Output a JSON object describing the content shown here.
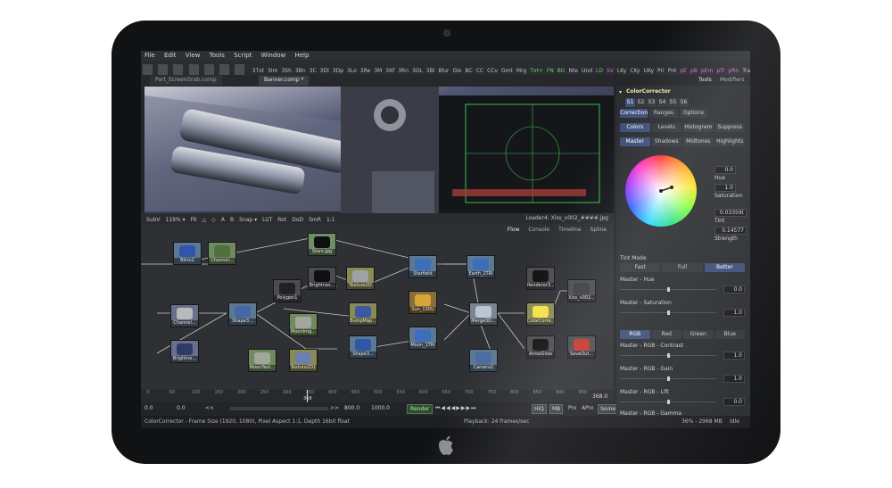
{
  "menu": [
    "File",
    "Edit",
    "View",
    "Tools",
    "Script",
    "Window",
    "Help"
  ],
  "toolbar": [
    {
      "label": "3Txt",
      "c": ""
    },
    {
      "label": "3Im",
      "c": ""
    },
    {
      "label": "3Sh",
      "c": ""
    },
    {
      "label": "3Bn",
      "c": ""
    },
    {
      "label": "3C",
      "c": ""
    },
    {
      "label": "3Dl",
      "c": ""
    },
    {
      "label": "3Dp",
      "c": ""
    },
    {
      "label": "3Lo",
      "c": ""
    },
    {
      "label": "3Re",
      "c": ""
    },
    {
      "label": "3M",
      "c": ""
    },
    {
      "label": "3Xf",
      "c": ""
    },
    {
      "label": "3Rn",
      "c": ""
    },
    {
      "label": "3DL",
      "c": ""
    },
    {
      "label": "3Bl",
      "c": ""
    },
    {
      "label": "Blur",
      "c": ""
    },
    {
      "label": "Glo",
      "c": ""
    },
    {
      "label": "BC",
      "c": ""
    },
    {
      "label": "CC",
      "c": ""
    },
    {
      "label": "CCv",
      "c": ""
    },
    {
      "label": "Gmt",
      "c": ""
    },
    {
      "label": "Mrg",
      "c": ""
    },
    {
      "label": "Txt+",
      "c": "g"
    },
    {
      "label": "FN",
      "c": "g"
    },
    {
      "label": "BG",
      "c": "g"
    },
    {
      "label": "Nte",
      "c": ""
    },
    {
      "label": "Und",
      "c": ""
    },
    {
      "label": "LD",
      "c": "g"
    },
    {
      "label": "SV",
      "c": "p"
    },
    {
      "label": "LKy",
      "c": ""
    },
    {
      "label": "CKy",
      "c": ""
    },
    {
      "label": "UKy",
      "c": ""
    },
    {
      "label": "Pri",
      "c": ""
    },
    {
      "label": "Pnt",
      "c": ""
    },
    {
      "label": "pE",
      "c": "p"
    },
    {
      "label": "pB",
      "c": "p"
    },
    {
      "label": "pEm",
      "c": "p"
    },
    {
      "label": "pTr",
      "c": "p"
    },
    {
      "label": "pRn",
      "c": "p"
    },
    {
      "label": "Tra",
      "c": ""
    }
  ],
  "doc_tabs": [
    "Part_ScreenGrab.comp",
    "Banner.comp *"
  ],
  "viewbar": {
    "items": [
      "SubV",
      "119% ▾",
      "Fit",
      "△",
      "◇",
      "A",
      "B",
      "Snap ▾",
      "LUT",
      "Rot",
      "DoD",
      "SmR",
      "1:1"
    ],
    "loader": "Loader4: Xiss_v002_####.jpg"
  },
  "flow_tabs": [
    "Flow",
    "Console",
    "Timeline",
    "Spline"
  ],
  "nodes": [
    {
      "label": "Blinn2",
      "bg": "#5d7893",
      "thumb": "#2f56a8"
    },
    {
      "label": "Channel...",
      "bg": "#6f8a5c",
      "thumb": "#50703f"
    },
    {
      "label": "Stars.jpg",
      "bg": "#6f8f66",
      "thumb": "#0e0f10"
    },
    {
      "label": "Brightnes...",
      "bg": "#4a4b4e",
      "thumb": "#0e0f10"
    },
    {
      "label": "Texture2D",
      "bg": "#8a8a54",
      "thumb": "#9fa2a6"
    },
    {
      "label": "Polygon1",
      "bg": "#4b4c50",
      "thumb": "#222"
    },
    {
      "label": "Starfield",
      "bg": "#5d7893",
      "thumb": "#3d6ebc"
    },
    {
      "label": "Earth_2TRI",
      "bg": "#5d7893",
      "thumb": "#3d6ebc"
    },
    {
      "label": "Renderer3...",
      "bg": "#4b4c50",
      "thumb": "#111"
    },
    {
      "label": "Xiss_v002...",
      "bg": "#4b4c50",
      "thumb": "#3a3d44"
    },
    {
      "label": "Channel...",
      "bg": "#66708a",
      "thumb": "#b9babc"
    },
    {
      "label": "Shape3...",
      "bg": "#5d7893",
      "thumb": "#4468a8"
    },
    {
      "label": "MoonImg...",
      "bg": "#6f8a5c",
      "thumb": "#a4a69e"
    },
    {
      "label": "BumpMap...",
      "bg": "#8a8a54",
      "thumb": "#3d58a2"
    },
    {
      "label": "Sun_130U",
      "bg": "#8a6d3b",
      "thumb": "#d8a53a"
    },
    {
      "label": "Merge3D...",
      "bg": "#7a8593",
      "thumb": "#bcc4cf"
    },
    {
      "label": "ColorCorre...",
      "bg": "#8a8a54",
      "thumb": "#f2e14a"
    },
    {
      "label": "Brightne...",
      "bg": "#66708a",
      "thumb": "#2e3b66"
    },
    {
      "label": "Moon_1TRI",
      "bg": "#5d7893",
      "thumb": "#3d6ebc"
    },
    {
      "label": "Shape3...",
      "bg": "#5d7893",
      "thumb": "#3056a6"
    },
    {
      "label": "MoonText...",
      "bg": "#6f8a5c",
      "thumb": "#a1a59b"
    },
    {
      "label": "Texture2D1",
      "bg": "#8a8a54",
      "thumb": "#6d7fb0"
    },
    {
      "label": "Camera1",
      "bg": "#5d7893",
      "thumb": "#4b6aa0"
    },
    {
      "label": "AnisoGlow",
      "bg": "#4b4c50",
      "thumb": "#111"
    },
    {
      "label": "SaveOut...",
      "bg": "#4b4c50",
      "thumb": "#c9322b"
    }
  ],
  "timeline": {
    "ticks": [
      "0",
      "50",
      "100",
      "150",
      "200",
      "250",
      "300",
      "350",
      "400",
      "450",
      "500",
      "550",
      "600",
      "650",
      "700",
      "750",
      "800",
      "850",
      "900",
      "950"
    ],
    "end_value": "368.0",
    "current_marker": "368"
  },
  "transport": {
    "start": "0.0",
    "render_start": "0.0",
    "render_end": "800.0",
    "end": "1000.0",
    "render_label": "Render",
    "hiq": "HiQ",
    "mb": "MB",
    "prx": "Prx",
    "aprx": "APrx",
    "some": "Some"
  },
  "status": {
    "left": "ColorCorrector - Frame Size (1920, 1080), Pixel Aspect 1:1, Depth 16bit float",
    "playback": "Playback: 24 frames/sec",
    "memory": "36% - 2968 MB",
    "state": "Idle"
  },
  "panel": {
    "tabs": [
      "Tools",
      "Modifiers"
    ],
    "tool_name": "ColorCorrector",
    "versions": [
      "S1",
      "S2",
      "S3",
      "S4",
      "S5",
      "S6"
    ],
    "subtabs": [
      "Correction",
      "Ranges",
      "Options"
    ],
    "modes": [
      "Colors",
      "Levels",
      "Histogram",
      "Suppress"
    ],
    "ranges": [
      "Master",
      "Shadows",
      "Midtones",
      "Highlights"
    ],
    "wheel_values": {
      "hue_label": "Hue",
      "hue_value": "0.0",
      "saturation_label": "Saturation",
      "saturation_value": "1.0",
      "tint_label": "Tint",
      "tint_value": "0.03359(",
      "strength_label": "Strength",
      "strength_value": "0.14577"
    },
    "tint_mode_label": "Tint Mode",
    "tint_modes": [
      "Fast",
      "Full",
      "Better"
    ],
    "sliders": [
      {
        "label": "Master - Hue",
        "value": "0.0",
        "level": 0.5
      },
      {
        "label": "Master - Saturation",
        "value": "1.0",
        "level": 0.5
      }
    ],
    "channels": [
      "RGB",
      "Red",
      "Green",
      "Blue"
    ],
    "rgb_sliders": [
      {
        "label": "Master - RGB - Contrast",
        "value": "1.0",
        "level": 0.5
      },
      {
        "label": "Master - RGB - Gain",
        "value": "1.0",
        "level": 0.5
      },
      {
        "label": "Master - RGB - Lift",
        "value": "0.0",
        "level": 0.5
      }
    ],
    "partial_label": "Master - RGB - Gamma"
  },
  "colors": {
    "accent": "#3d4f7a",
    "bezel": "#111214",
    "ui_bg": "#2b2d31"
  }
}
